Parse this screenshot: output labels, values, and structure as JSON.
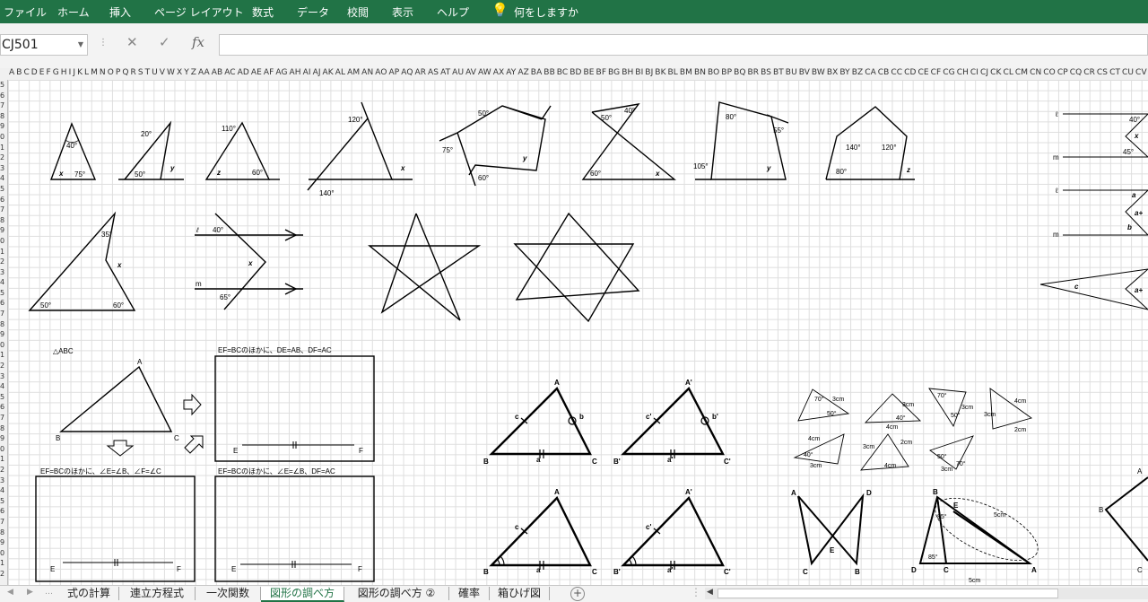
{
  "menu": {
    "file": "ファイル",
    "home": "ホーム",
    "insert": "挿入",
    "page_layout": "ページ レイアウト",
    "formulas": "数式",
    "data": "データ",
    "review": "校閲",
    "view": "表示",
    "help": "ヘルプ",
    "tell_me": "何をしますか"
  },
  "formula_bar": {
    "name_box": "CJ501",
    "fx": "fx",
    "cancel": "✕",
    "enter": "✓",
    "formula_value": ""
  },
  "column_headers": "A B C D E F G H I J K L M N O P Q R S T U V W X Y Z AA AB AC AD AE AF AG AH AI AJ AK AL AM AN AO AP AQ AR AS AT AU AV AW AX AY AZ BA BB BC BD BE BF BG BH BI BJ BK BL BM BN BO BP BQ BR BS BT BU BV BW BX BY BZ CA CB CC CD CE CF CG CH CI CJ CK CL CM CN CO CP CQ CR CS CT CU CV CW CX CY",
  "row_headers": "5 6 7 8 9 0 1 2 3 4 5 6 7 8 9 0 1 2 3 4 5 6 7 8 9 0 1 2 3 4 5 6 7 8 9 0 1 2 3 4 5 6 7 8 9 0 1 2",
  "figures": {
    "angles": {
      "t1_top": "40°",
      "t1_x": "x",
      "t1_right": "75°",
      "t2_top": "20°",
      "t2_left": "50°",
      "t2_y": "y",
      "t3_top": "110°",
      "t3_z": "z",
      "t3_right": "60°",
      "t4_top": "120°",
      "t4_x": "x",
      "t4_bottom": "140°",
      "p1_top": "50°",
      "p1_left": "75°",
      "p1_bottom": "60°",
      "p1_y": "y",
      "bt_left": "50°",
      "bt_right": "40°",
      "bt_bottom_left": "60°",
      "bt_x": "x",
      "q_tl": "80°",
      "q_tr": "55°",
      "q_bl": "105°",
      "q_y": "y",
      "pent_l": "140°",
      "pent_r": "120°",
      "pent_bl": "80°",
      "pent_z": "z",
      "big_35": "35°",
      "big_x": "x",
      "big_50": "50°",
      "big_60": "60°",
      "par_l": "ℓ",
      "par_40": "40°",
      "par_x": "x",
      "par_m": "m",
      "par_65": "65°"
    },
    "right_edge": {
      "l1": "ℓ",
      "m1": "m",
      "a40": "40°",
      "x": "x",
      "a45": "45°",
      "l2": "ℓ",
      "m2": "m",
      "a": "a",
      "aplus": "a+",
      "b": "b",
      "c": "c",
      "aplus2": "a+"
    },
    "congruence": {
      "abc_title": "△ABC",
      "A": "A",
      "B": "B",
      "C": "C",
      "box1_caption": "EF=BCのほかに、DE=AB、DF=AC",
      "box2_caption": "EF=BCのほかに、∠E=∠B、∠F=∠C",
      "box3_caption": "EF=BCのほかに、∠E=∠B、DF=AC",
      "E": "E",
      "F": "F"
    },
    "pairs": {
      "A": "A",
      "B": "B",
      "C": "C",
      "a": "a",
      "b": "b",
      "c": "c",
      "A2": "A'",
      "B2": "B'",
      "C2": "C'",
      "a2": "a'",
      "b2": "b'",
      "c2": "c'"
    },
    "small_tris": {
      "s1a": "70°",
      "s1b": "50°",
      "s1c": "3cm",
      "s2a": "3cm",
      "s2b": "40°",
      "s2c": "4cm",
      "s3a": "70°",
      "s3b": "50°",
      "s3c": "3cm",
      "s4a": "4cm",
      "s4b": "3cm",
      "s4c": "2cm",
      "s5a": "4cm",
      "s5b": "40°",
      "s5c": "3cm",
      "s6a": "3cm",
      "s6b": "2cm",
      "s6c": "4cm",
      "s7a": "50°",
      "s7b": "70°",
      "s7c": "3cm"
    },
    "cross": {
      "A": "A",
      "D": "D",
      "E": "E",
      "C": "C",
      "B": "B"
    },
    "last": {
      "B": "B",
      "E": "E",
      "a85": "85°",
      "a85b": "85°",
      "D": "D",
      "C": "C",
      "A": "A",
      "len5": "5cm",
      "len5b": "5cm"
    },
    "edge_rhombus": {
      "A": "A",
      "B": "B",
      "C": "C"
    }
  },
  "tabs": {
    "t1": "式の計算",
    "t2": "連立方程式",
    "t3": "一次関数",
    "t4": "図形の調べ方",
    "t5": "図形の調べ方 ②",
    "t6": "確率",
    "t7": "箱ひげ図"
  },
  "colors": {
    "excel_green": "#217346"
  }
}
